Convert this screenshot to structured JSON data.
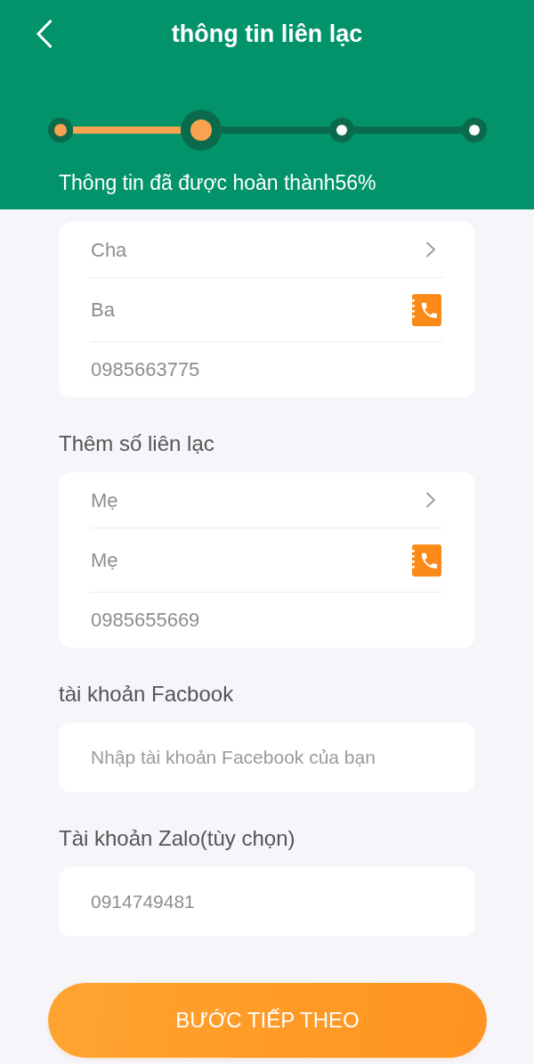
{
  "header": {
    "title": "thông tin liên lạc",
    "steps": [
      {
        "reached": true,
        "selected": false
      },
      {
        "reached": true,
        "selected": true
      },
      {
        "reached": false,
        "selected": false
      },
      {
        "reached": false,
        "selected": false
      }
    ],
    "progress_text": "Thông tin đã được hoàn thành56%"
  },
  "sections": [
    {
      "kind": "contact",
      "relation": "Cha",
      "name": "Ba",
      "phone": "0985663775"
    },
    {
      "kind": "contact",
      "label": "Thêm số liên lạc",
      "relation": "Mẹ",
      "name": "Mẹ",
      "phone": "0985655669"
    },
    {
      "kind": "input",
      "label": "tài khoản Facbook",
      "placeholder": "Nhập tài khoản Facebook của bạn"
    },
    {
      "kind": "input",
      "label": "Tài khoản Zalo(tùy chọn)",
      "value": "0914749481"
    }
  ],
  "next_button": {
    "label": "BƯỚC TIẾP THEO"
  }
}
